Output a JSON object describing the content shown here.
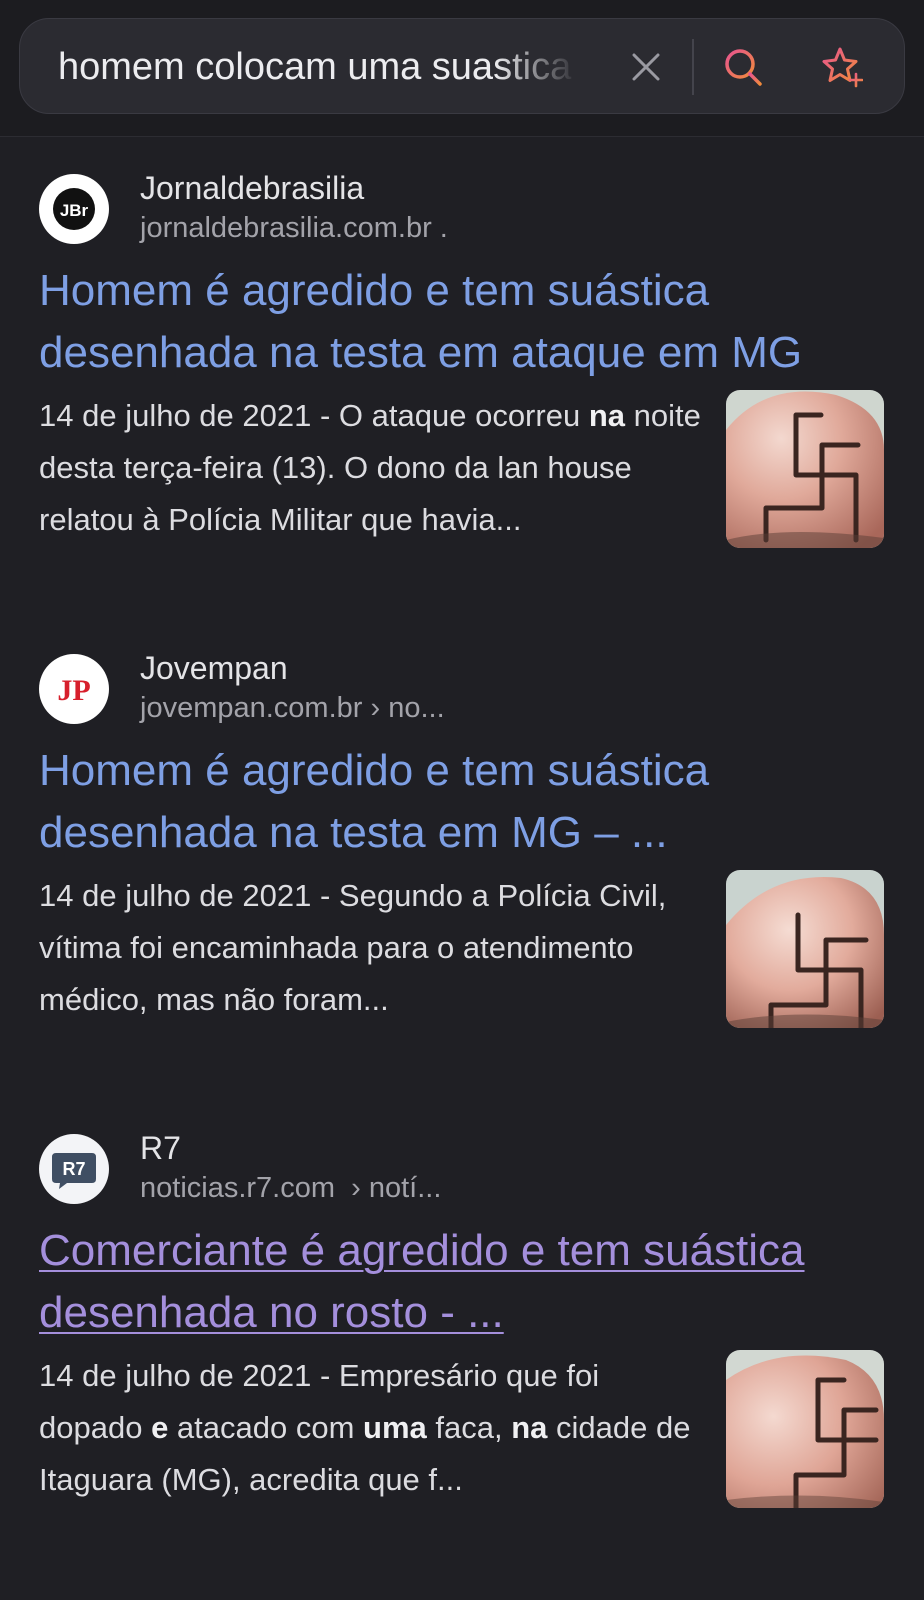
{
  "search": {
    "query": "homem colocam uma suastica"
  },
  "results": [
    {
      "site_name": "Jornaldebrasilia",
      "site_url": "jornaldebrasilia.com.br .",
      "favicon_text": "JBr",
      "title": "Homem é agredido e tem suástica desenhada na testa em ataque em MG",
      "snippet": {
        "date": "14 de julho de 2021",
        "sep": " - ",
        "p1": "O ataque ocorreu ",
        "b1": "na",
        "p2": " noite desta terça-feira (13). O dono da lan house relatou à Polícia Militar que havia..."
      }
    },
    {
      "site_name": "Jovempan",
      "site_url": "jovempan.com.br › no...",
      "favicon_text": "JP",
      "title": "Homem é agredido e tem suástica desenhada na testa em MG – ...",
      "snippet": {
        "date": "14 de julho de 2021",
        "sep": " - ",
        "p1": "Segundo a Polícia Civil, vítima foi encaminhada para o atendimento médico, mas não foram..."
      }
    },
    {
      "site_name": "R7",
      "site_url": "noticias.r7.com  › notí...",
      "favicon_text": "R7",
      "title": "Comerciante é agredido e tem suástica desenhada no rosto - ...",
      "snippet": {
        "date": "14 de julho de 2021",
        "sep": " - ",
        "p1": "Empresário que foi dopado ",
        "b1": "e",
        "p2": " atacado com ",
        "b2": "uma",
        "p3": " faca, ",
        "b3": "na",
        "p4": " cidade de Itaguara (MG), acredita que f..."
      }
    }
  ],
  "colors": {
    "background": "#1f1f24",
    "link": "#7e9fe4",
    "visited_link": "#a48fdc",
    "search_icon_gradient": [
      "#e8558f",
      "#f08a3c"
    ],
    "jp_red": "#d71f2c"
  }
}
